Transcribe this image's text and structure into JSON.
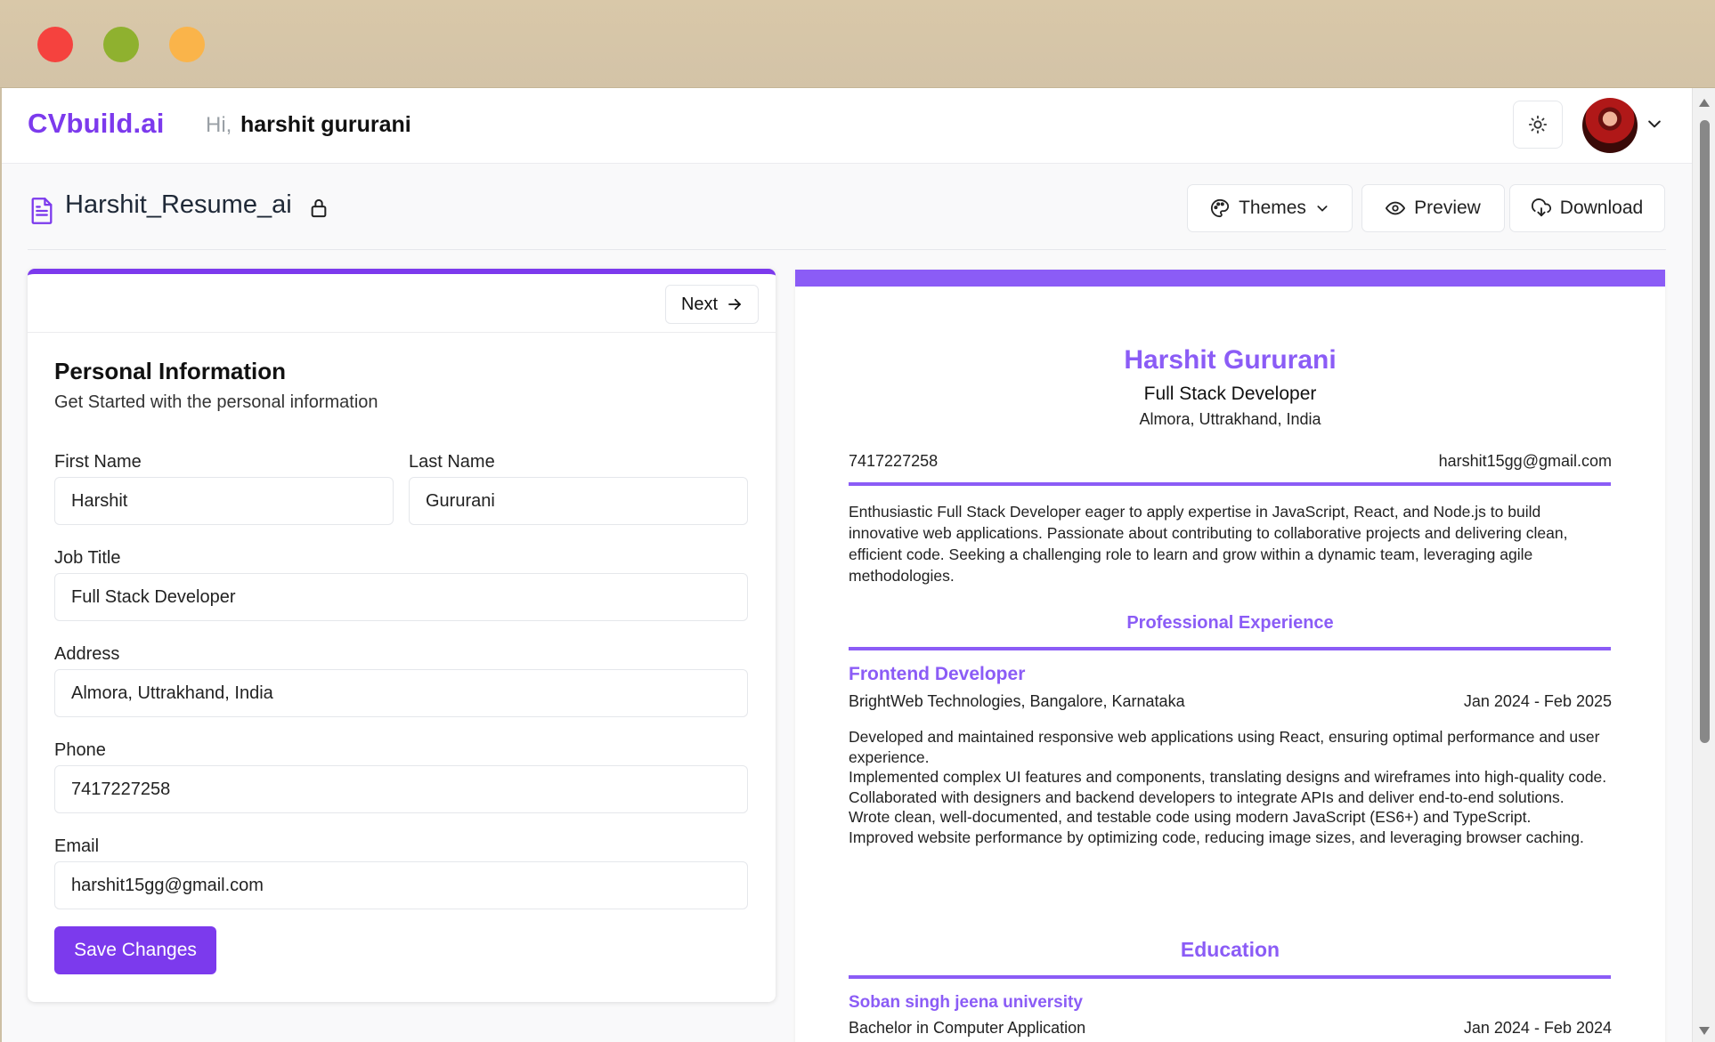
{
  "window": {
    "controls": [
      "close",
      "minimize",
      "maximize"
    ]
  },
  "header": {
    "logo": "CVbuild.ai",
    "greeting": "Hi,",
    "user_name": "harshit gururani",
    "theme_toggle_icon": "sun-icon",
    "avatar_icon": "avatar"
  },
  "toolbar": {
    "doc_title": "Harshit_Resume_ai",
    "themes_label": "Themes",
    "preview_label": "Preview",
    "download_label": "Download"
  },
  "form": {
    "next_label": "Next",
    "title": "Personal Information",
    "subtitle": "Get Started with the personal information",
    "first_name_label": "First Name",
    "first_name_value": "Harshit",
    "last_name_label": "Last Name",
    "last_name_value": "Gururani",
    "job_title_label": "Job Title",
    "job_title_value": "Full Stack Developer",
    "address_label": "Address",
    "address_value": "Almora, Uttrakhand, India",
    "phone_label": "Phone",
    "phone_value": "7417227258",
    "email_label": "Email",
    "email_value": "harshit15gg@gmail.com",
    "save_label": "Save Changes"
  },
  "preview": {
    "name": "Harshit Gururani",
    "job_title": "Full Stack Developer",
    "address": "Almora, Uttrakhand, India",
    "phone": "7417227258",
    "email": "harshit15gg@gmail.com",
    "summary": "Enthusiastic Full Stack Developer eager to apply expertise in JavaScript, React, and Node.js to build innovative web applications. Passionate about contributing to collaborative projects and delivering clean, efficient code. Seeking a challenging role to learn and grow within a dynamic team, leveraging agile methodologies.",
    "experience_heading": "Professional Experience",
    "experience": {
      "role": "Frontend Developer",
      "company": "BrightWeb Technologies, Bangalore, Karnataka",
      "dates": "Jan 2024 - Feb 2025",
      "bullets": [
        "Developed and maintained responsive web applications using React, ensuring optimal performance and user experience.",
        "Implemented complex UI features and components, translating designs and wireframes into high-quality code.",
        "Collaborated with designers and backend developers to integrate APIs and deliver end-to-end solutions.",
        "Wrote clean, well-documented, and testable code using modern JavaScript (ES6+) and TypeScript.",
        "Improved website performance by optimizing code, reducing image sizes, and leveraging browser caching."
      ]
    },
    "education_heading": "Education",
    "education": {
      "school": "Soban singh jeena university",
      "degree": "Bachelor in Computer Application",
      "dates": "Jan 2024 - Feb 2024"
    }
  },
  "colors": {
    "accent": "#7c3aed",
    "preview_accent": "#8b5cf6"
  }
}
